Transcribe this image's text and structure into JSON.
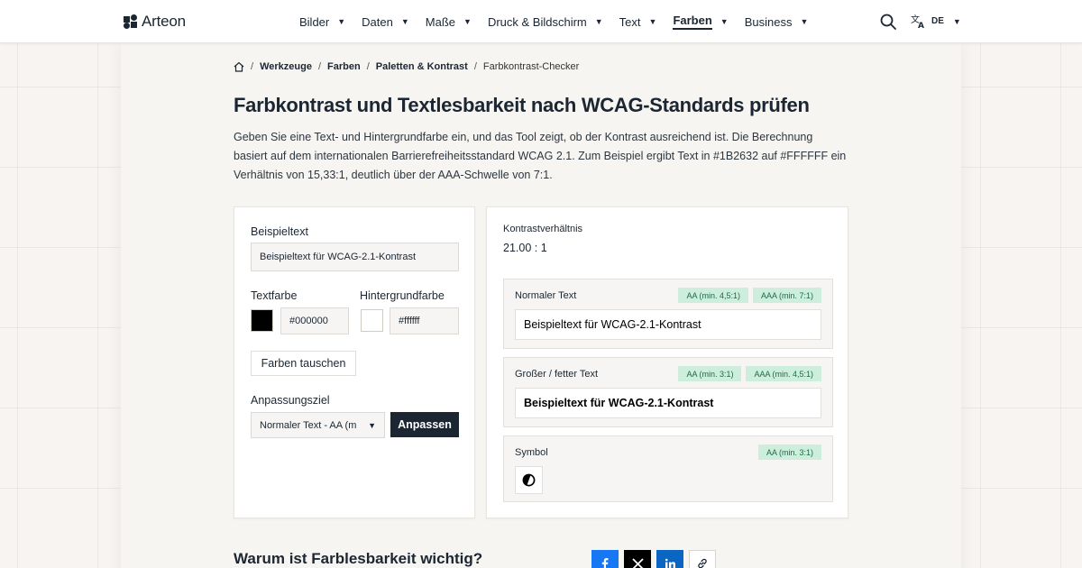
{
  "brand": {
    "name": "Arteon",
    "logo_icon": "arteon-logo-icon"
  },
  "nav": {
    "items": [
      {
        "label": "Bilder",
        "active": false
      },
      {
        "label": "Daten",
        "active": false
      },
      {
        "label": "Maße",
        "active": false
      },
      {
        "label": "Druck & Bildschirm",
        "active": false
      },
      {
        "label": "Text",
        "active": false
      },
      {
        "label": "Farben",
        "active": true
      },
      {
        "label": "Business",
        "active": false
      }
    ],
    "search_icon": "search-icon",
    "language_icon": "translate-icon",
    "language_code": "DE"
  },
  "breadcrumb": {
    "home_icon": "home-icon",
    "items": [
      "Werkzeuge",
      "Farben",
      "Paletten & Kontrast"
    ],
    "current": "Farbkontrast-Checker"
  },
  "page": {
    "title": "Farbkontrast und Textlesbarkeit nach WCAG-Standards prüfen",
    "intro": "Geben Sie eine Text- und Hintergrundfarbe ein, und das Tool zeigt, ob der Kontrast ausreichend ist. Die Berechnung basiert auf dem internationalen Barrierefreiheitsstandard WCAG 2.1. Zum Beispiel ergibt Text in #1B2632 auf #FFFFFF ein Verhältnis von 15,33:1, deutlich über der AAA-Schwelle von 7:1."
  },
  "form": {
    "sample_label": "Beispieltext",
    "sample_value": "Beispieltext für WCAG-2.1-Kontrast",
    "text_color_label": "Textfarbe",
    "text_color_value": "#000000",
    "text_color_swatch": "#000000",
    "bg_color_label": "Hintergrundfarbe",
    "bg_color_value": "#ffffff",
    "bg_color_swatch": "#ffffff",
    "swap_button": "Farben tauschen",
    "target_label": "Anpassungsziel",
    "target_value": "Normaler Text - AA (m",
    "adjust_button": "Anpassen"
  },
  "results": {
    "ratio_label": "Kontrastverhältnis",
    "ratio_value": "21.00 : 1",
    "normal": {
      "title": "Normaler Text",
      "badges": [
        "AA (min. 4,5:1)",
        "AAA (min. 7:1)"
      ],
      "sample": "Beispieltext für WCAG-2.1-Kontrast"
    },
    "large": {
      "title": "Großer / fetter Text",
      "badges": [
        "AA (min. 3:1)",
        "AAA (min. 4,5:1)"
      ],
      "sample": "Beispieltext für WCAG-2.1-Kontrast"
    },
    "symbol": {
      "title": "Symbol",
      "badges": [
        "AA (min. 3:1)"
      ],
      "icon": "contrast-icon"
    },
    "badge_bg": "#cdeedd",
    "badge_fg": "#1d6b45"
  },
  "bottom": {
    "section_title": "Warum ist Farblesbarkeit wichtig?",
    "share_icons": [
      "facebook-icon",
      "x-icon",
      "linkedin-icon",
      "link-icon"
    ],
    "share_colors": [
      "#1877f2",
      "#000000",
      "#0a66c2",
      "#ffffff"
    ]
  },
  "colors": {
    "primary": "#1b2632",
    "page_bg": "#f7f4f1"
  }
}
